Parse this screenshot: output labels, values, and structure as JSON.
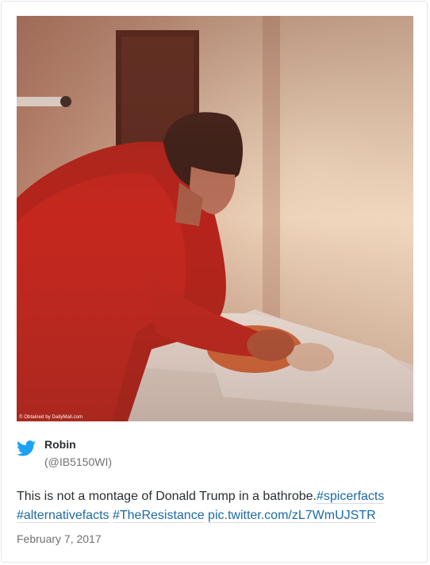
{
  "media": {
    "credit": "© Obtained by DailyMail.com"
  },
  "author": {
    "name": "Robin",
    "handle": "(@IB5150WI)",
    "icon": "twitter-bird-icon"
  },
  "tweet": {
    "text": "This is not a montage of Donald Trump in a bathrobe.",
    "hashtag_1": "#spicerfacts",
    "hashtag_2": "#alternativefacts",
    "hashtag_3": "#TheResistance",
    "link": "pic.twitter.com/zL7WmUJSTR"
  },
  "date": "February 7, 2017",
  "colors": {
    "link": "#1b6aa5",
    "twitter_blue": "#1da1f2",
    "text": "#292f33",
    "muted": "#707070"
  }
}
